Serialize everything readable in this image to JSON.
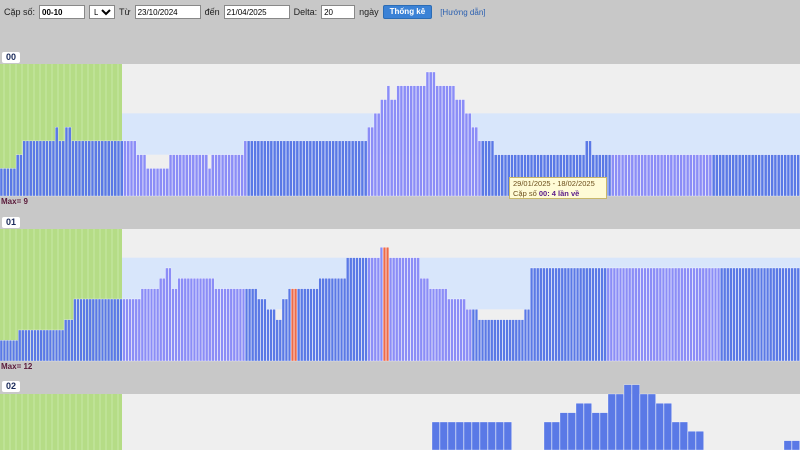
{
  "toolbar": {
    "cap_so_label": "Cặp số:",
    "cap_so_value": "00-10",
    "mode_value": "Lô",
    "mode_options": [
      "Lô"
    ],
    "tu_label": "Từ",
    "from_date": "23/10/2024",
    "den_label": "đến",
    "to_date": "21/04/2025",
    "delta_label": "Delta:",
    "delta_value": "20",
    "ngay_label": "ngày",
    "stat_button": "Thống kê",
    "help_link": "[Hướng dẫn]"
  },
  "colors": {
    "background": "#c8c8c8",
    "chart_bg": "#efefef",
    "band": "#d8e6fb",
    "green": "#b5dc86",
    "bar_blue": "#5a79e6",
    "bar_lavender": "#8b8df7",
    "bar_red": "#ee6a4a",
    "button": "#3b82d6"
  },
  "panels": [
    {
      "label": "00",
      "max_label": "Max= 9"
    },
    {
      "label": "01",
      "max_label": "Max= 12"
    },
    {
      "label": "02",
      "max_label": ""
    }
  ],
  "tooltip": {
    "date_range": "29/01/2025 - 18/02/2025",
    "pair_text": "Cặp số ",
    "pair_num": "00",
    "count_text": ": 4 lần về"
  },
  "chart_data": [
    {
      "type": "bar",
      "title": "00",
      "max": 9,
      "band": [
        3,
        6
      ],
      "values": [
        2,
        2,
        2,
        2,
        2,
        3,
        3,
        4,
        4,
        4,
        4,
        4,
        4,
        4,
        4,
        4,
        4,
        5,
        4,
        4,
        5,
        5,
        4,
        4,
        4,
        4,
        4,
        4,
        4,
        4,
        4,
        4,
        4,
        4,
        4,
        4,
        4,
        4,
        4,
        4,
        4,
        4,
        3,
        3,
        3,
        2,
        2,
        2,
        2,
        2,
        2,
        2,
        3,
        3,
        3,
        3,
        3,
        3,
        3,
        3,
        3,
        3,
        3,
        3,
        2,
        3,
        3,
        3,
        3,
        3,
        3,
        3,
        3,
        3,
        3,
        4,
        4,
        4,
        4,
        4,
        4,
        4,
        4,
        4,
        4,
        4,
        4,
        4,
        4,
        4,
        4,
        4,
        4,
        4,
        4,
        4,
        4,
        4,
        4,
        4,
        4,
        4,
        4,
        4,
        4,
        4,
        4,
        4,
        4,
        4,
        4,
        4,
        4,
        5,
        5,
        6,
        6,
        7,
        7,
        8,
        7,
        7,
        8,
        8,
        8,
        8,
        8,
        8,
        8,
        8,
        8,
        9,
        9,
        9,
        8,
        8,
        8,
        8,
        8,
        8,
        7,
        7,
        7,
        6,
        6,
        5,
        5,
        4,
        4,
        4,
        4,
        4,
        3,
        3,
        3,
        3,
        3,
        3,
        3,
        3,
        3,
        3,
        3,
        3,
        3,
        3,
        3,
        3,
        3,
        3,
        3,
        3,
        3,
        3,
        3,
        3,
        3,
        3,
        3,
        3,
        4,
        4,
        3,
        3,
        3,
        3,
        3,
        3,
        3,
        3,
        3,
        3,
        3,
        3,
        3,
        3,
        3,
        3,
        3,
        3,
        3,
        3,
        3,
        3,
        3,
        3,
        3,
        3,
        3,
        3,
        3,
        3,
        3,
        3,
        3,
        3,
        3,
        3,
        3,
        3,
        3,
        3,
        3,
        3,
        3,
        3,
        3,
        3,
        3,
        3,
        3,
        3,
        3,
        3,
        3,
        3,
        3,
        3,
        3,
        3,
        3,
        3,
        3,
        3,
        3,
        3
      ],
      "red_indices": []
    },
    {
      "type": "bar",
      "title": "01",
      "max": 12,
      "band": [
        5,
        10
      ],
      "values": [
        2,
        2,
        2,
        2,
        2,
        2,
        3,
        3,
        3,
        3,
        3,
        3,
        3,
        3,
        3,
        3,
        3,
        3,
        3,
        3,
        3,
        4,
        4,
        4,
        6,
        6,
        6,
        6,
        6,
        6,
        6,
        6,
        6,
        6,
        6,
        6,
        6,
        6,
        6,
        6,
        6,
        6,
        6,
        6,
        6,
        6,
        7,
        7,
        7,
        7,
        7,
        7,
        8,
        8,
        9,
        9,
        7,
        7,
        8,
        8,
        8,
        8,
        8,
        8,
        8,
        8,
        8,
        8,
        8,
        8,
        7,
        7,
        7,
        7,
        7,
        7,
        7,
        7,
        7,
        7,
        7,
        7,
        7,
        7,
        6,
        6,
        6,
        5,
        5,
        5,
        4,
        4,
        6,
        6,
        7,
        7,
        7,
        7,
        7,
        7,
        7,
        7,
        7,
        7,
        8,
        8,
        8,
        8,
        8,
        8,
        8,
        8,
        8,
        10,
        10,
        10,
        10,
        10,
        10,
        10,
        10,
        10,
        10,
        10,
        11,
        11,
        11,
        10,
        10,
        10,
        10,
        10,
        10,
        10,
        10,
        10,
        10,
        8,
        8,
        8,
        7,
        7,
        7,
        7,
        7,
        7,
        6,
        6,
        6,
        6,
        6,
        6,
        5,
        5,
        5,
        5,
        4,
        4,
        4,
        4,
        4,
        4,
        4,
        4,
        4,
        4,
        4,
        4,
        4,
        4,
        4,
        5,
        5,
        9,
        9,
        9,
        9,
        9,
        9,
        9,
        9,
        9,
        9,
        9,
        9,
        9,
        9,
        9,
        9,
        9,
        9,
        9,
        9,
        9,
        9,
        9,
        9,
        9,
        9,
        9,
        9,
        9,
        9,
        9,
        9,
        9,
        9,
        9,
        9,
        9,
        9,
        9,
        9,
        9,
        9,
        9,
        9,
        9,
        9,
        9,
        9,
        9,
        9,
        9,
        9,
        9,
        9,
        9,
        9,
        9,
        9,
        9,
        9,
        9,
        9,
        9,
        9,
        9,
        9,
        9,
        9,
        9,
        9,
        9,
        9,
        9,
        9,
        9,
        9,
        9,
        9,
        9,
        9,
        9,
        9,
        9,
        9,
        9,
        9,
        9,
        9
      ],
      "red_indices": [
        95,
        96,
        125,
        126
      ]
    },
    {
      "type": "bar",
      "title": "02",
      "values": [
        0,
        0,
        0,
        0,
        0,
        0,
        0,
        0,
        0,
        0,
        0,
        0,
        0,
        0,
        0,
        0,
        0,
        0,
        0,
        0,
        0,
        0,
        0,
        0,
        0,
        0,
        0,
        0,
        0,
        0,
        0,
        0,
        0,
        0,
        0,
        0,
        0,
        0,
        0,
        0,
        0,
        0,
        0,
        0,
        0,
        0,
        0,
        0,
        0,
        0,
        0,
        0,
        0,
        0,
        3,
        3,
        3,
        3,
        3,
        3,
        3,
        3,
        3,
        3,
        0,
        0,
        0,
        0,
        3,
        3,
        4,
        4,
        5,
        5,
        4,
        4,
        6,
        6,
        7,
        7,
        6,
        6,
        5,
        5,
        3,
        3,
        2,
        2,
        0,
        0,
        0,
        0,
        0,
        0,
        0,
        0,
        0,
        0,
        1,
        1
      ],
      "red_indices": []
    }
  ]
}
